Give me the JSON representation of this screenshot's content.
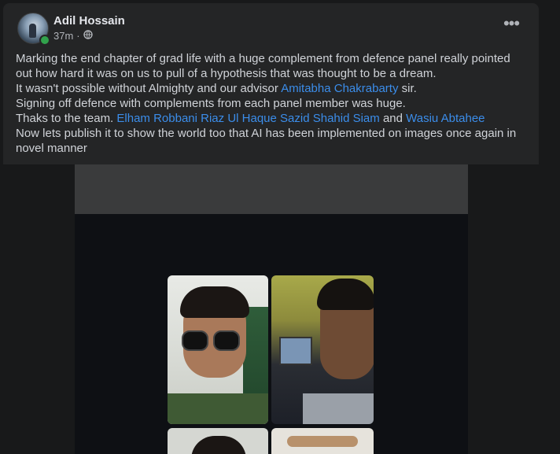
{
  "post": {
    "author": "Adil Hossain",
    "time": "37m",
    "separator": "·",
    "privacy_icon": "globe-icon",
    "more_icon": "more-horizontal-icon",
    "more_label": "•••",
    "lines": {
      "l1": "Marking the end chapter of grad life with a huge complement from defence panel really pointed out how  hard it was on us to pull of a hypothesis that was thought to be a dream.",
      "l2_pre": "It wasn't possible without Almighty and our advisor ",
      "l2_link": "Amitabha Chakrabarty",
      "l2_post": " sir.",
      "l3": "Signing off defence with complements from each panel member was huge.",
      "l4_pre": "Thaks to the team. ",
      "l4_link1": "Elham Robbani",
      "l4_link2": "Riaz Ul Haque",
      "l4_link3": "Sazid Shahid Siam",
      "l4_mid": " and ",
      "l4_link4": "Wasiu Abtahee",
      "l5": "Now lets publish it to show the world too that AI has been implemented on images once again in novel manner"
    }
  },
  "colors": {
    "background": "#18191a",
    "card": "#242526",
    "link": "#3b8dea",
    "online": "#31a24c"
  }
}
